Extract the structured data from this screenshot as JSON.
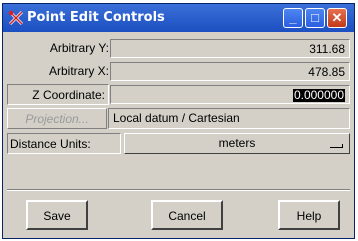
{
  "window": {
    "title": "Point Edit Controls",
    "icons": [
      "point-edit-icon",
      "minimize-icon",
      "maximize-icon",
      "close-icon"
    ]
  },
  "fields": {
    "arbitrary_y": {
      "label": "Arbitrary Y:",
      "value": "311.68"
    },
    "arbitrary_x": {
      "label": "Arbitrary X:",
      "value": "478.85"
    },
    "z_coordinate": {
      "label": "Z Coordinate:",
      "value": "0.000000"
    }
  },
  "projection": {
    "button_label": "Projection...",
    "value": "Local datum / Cartesian"
  },
  "distance_units": {
    "label": "Distance Units:",
    "selected": "meters"
  },
  "buttons": {
    "save": "Save",
    "cancel": "Cancel",
    "help": "Help"
  },
  "colors": {
    "titlebar": "#1c4fc0",
    "face": "#d4d0c8",
    "close": "#c0391a"
  }
}
